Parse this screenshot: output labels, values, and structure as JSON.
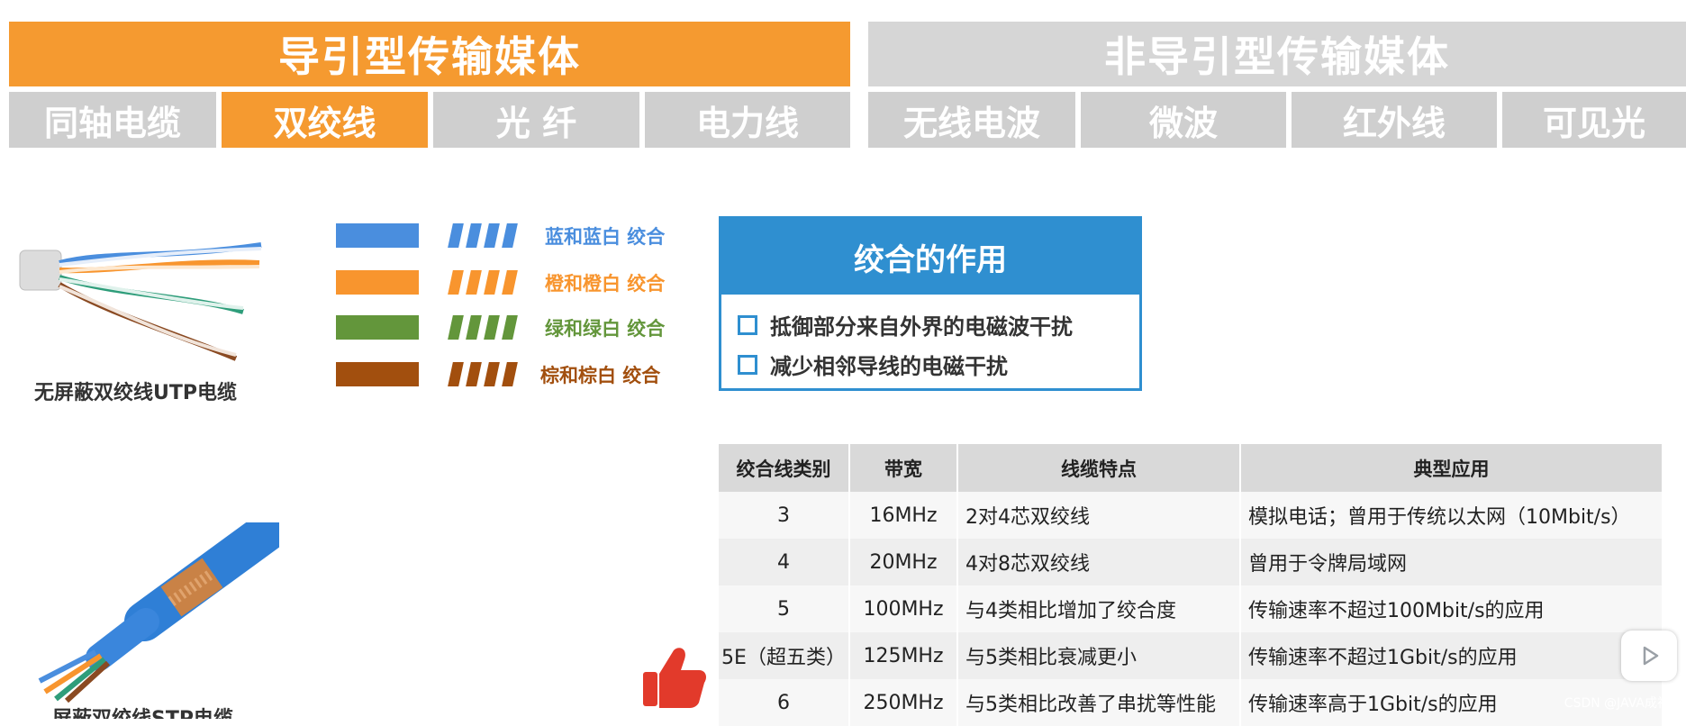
{
  "headers": {
    "guided": "导引型传输媒体",
    "unguided": "非导引型传输媒体"
  },
  "tabs": [
    "同轴电缆",
    "双绞线",
    "光  纤",
    "电力线",
    "无线电波",
    "微波",
    "红外线",
    "可见光"
  ],
  "colors": {
    "orange": "#f59a30",
    "gray": "#cfcfcf",
    "blue_accent": "#2f8fd0",
    "wire_blue": "#4a8ede",
    "wire_orange": "#f8952e",
    "wire_green": "#63963b",
    "wire_brown": "#a24f0e"
  },
  "wires": [
    {
      "label": "蓝和蓝白 绞合",
      "color": "#4a8ede"
    },
    {
      "label": "橙和橙白 绞合",
      "color": "#f8952e"
    },
    {
      "label": "绿和绿白 绞合",
      "color": "#63963b"
    },
    {
      "label": "棕和棕白 绞合",
      "color": "#a24f0e"
    }
  ],
  "captions": {
    "utp": "无屏蔽双绞线UTP电缆",
    "stp": "屏蔽双绞线STP电缆"
  },
  "twist_box": {
    "title": "绞合的作用",
    "items": [
      "抵御部分来自外界的电磁波干扰",
      "减少相邻导线的电磁干扰"
    ]
  },
  "table": {
    "headers": [
      "绞合线类别",
      "带宽",
      "线缆特点",
      "典型应用"
    ],
    "rows": [
      [
        "3",
        "16MHz",
        "2对4芯双绞线",
        "模拟电话；曾用于传统以太网（10Mbit/s）"
      ],
      [
        "4",
        "20MHz",
        "4对8芯双绞线",
        "曾用于令牌局域网"
      ],
      [
        "5",
        "100MHz",
        "与4类相比增加了绞合度",
        "传输速率不超过100Mbit/s的应用"
      ],
      [
        "5E（超五类）",
        "125MHz",
        "与5类相比衰减更小",
        "传输速率不超过1Gbit/s的应用"
      ],
      [
        "6",
        "250MHz",
        "与5类相比改善了串扰等性能",
        "传输速率高于1Gbit/s的应用"
      ]
    ]
  },
  "watermark": "CSDN @JAVA成神"
}
